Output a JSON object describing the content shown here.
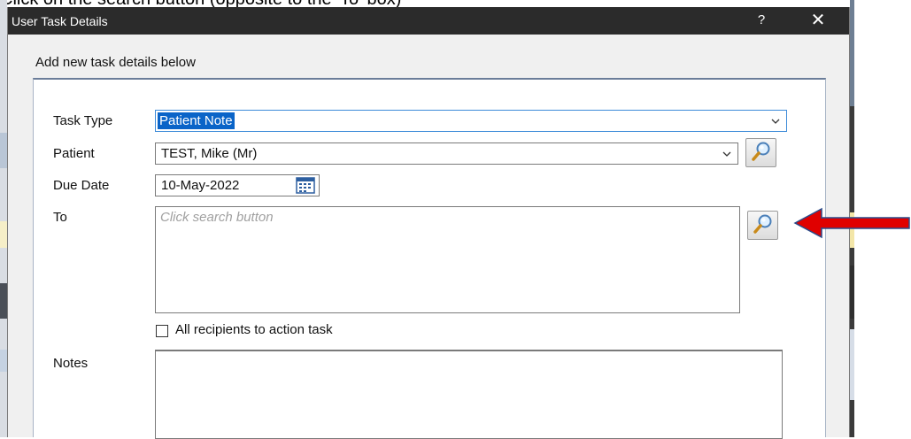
{
  "caption": "Click on the search button (opposite to the 'To' box)",
  "window": {
    "title": "User Task Details",
    "help_label": "?",
    "close_label": "✕"
  },
  "form": {
    "subtitle": "Add new task details below",
    "task_type": {
      "label": "Task Type",
      "value": "Patient Note"
    },
    "patient": {
      "label": "Patient",
      "value": "TEST, Mike (Mr)"
    },
    "due_date": {
      "label": "Due Date",
      "value": "10-May-2022"
    },
    "to": {
      "label": "To",
      "placeholder": "Click search button"
    },
    "all_recipients": {
      "label": "All recipients to action task",
      "checked": false
    },
    "notes": {
      "label": "Notes",
      "value": ""
    }
  },
  "annotation": {
    "arrow_color": "#e00000",
    "points_to": "to-search-button"
  },
  "icons": [
    "chevron-down-icon",
    "magnifier-icon",
    "calendar-icon",
    "arrow-left-icon"
  ],
  "colors": {
    "titlebar": "#2b2b2b",
    "selection": "#0a64c8",
    "panel_border": "#6b7d99"
  }
}
